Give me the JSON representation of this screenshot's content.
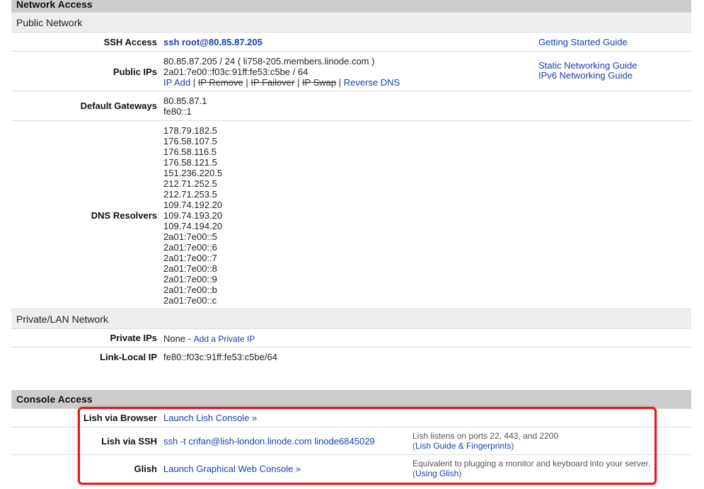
{
  "network": {
    "title": "Network Access",
    "public_title": "Public Network",
    "ssh": {
      "label": "SSH Access",
      "value": "ssh root@80.85.87.205",
      "guide": "Getting Started Guide"
    },
    "public_ips": {
      "label": "Public IPs",
      "ipv4": "80.85.87.205 / 24 ( li758-205.members.linode.com )",
      "ipv6": "2a01:7e00::f03c:91ff:fe53:c5be / 64",
      "actions": [
        "IP Add",
        "IP Remove",
        "IP Failover",
        "IP Swap",
        "Reverse DNS"
      ],
      "guides": [
        "Static Networking Guide",
        "IPv6 Networking Guide"
      ]
    },
    "gateways": {
      "label": "Default Gateways",
      "values": [
        "80.85.87.1",
        "fe80::1"
      ]
    },
    "dns": {
      "label": "DNS Resolvers",
      "values": [
        "178.79.182.5",
        "176.58.107.5",
        "176.58.116.5",
        "176.58.121.5",
        "151.236.220.5",
        "212.71.252.5",
        "212.71.253.5",
        "109.74.192.20",
        "109.74.193.20",
        "109.74.194.20",
        "2a01:7e00::5",
        "2a01:7e00::6",
        "2a01:7e00::7",
        "2a01:7e00::8",
        "2a01:7e00::9",
        "2a01:7e00::b",
        "2a01:7e00::c"
      ]
    },
    "private_title": "Private/LAN Network",
    "private_ips": {
      "label": "Private IPs",
      "prefix": "None - ",
      "link": "Add a Private IP"
    },
    "link_local": {
      "label": "Link-Local IP",
      "value": "fe80::f03c:91ff:fe53:c5be/64"
    }
  },
  "console": {
    "title": "Console Access",
    "browser": {
      "label": "Lish via Browser",
      "link": "Launch Lish Console »"
    },
    "ssh": {
      "label": "Lish via SSH",
      "value": "ssh -t crifan@lish-london.linode.com linode6845029",
      "note": "Lish listens on ports 22, 443, and 2200",
      "note_link": "Lish Guide & Fingerprints"
    },
    "glish": {
      "label": "Glish",
      "link": "Launch Graphical Web Console »",
      "note": "Equivalent to plugging a monitor and keyboard into your server.",
      "note_link": "Using Glish"
    }
  },
  "colors": {
    "link": "#1a3fb0",
    "section_header": "#cccccc",
    "subsection": "#eeeeee",
    "highlight": "#e01b1b"
  }
}
